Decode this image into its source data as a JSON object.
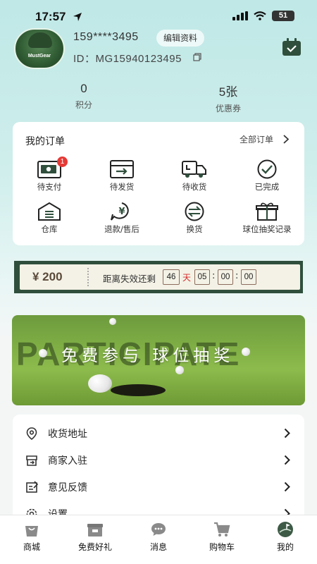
{
  "status": {
    "time": "17:57",
    "battery": "51"
  },
  "profile": {
    "phone": "159****3495",
    "edit_label": "编辑资料",
    "user_id": "ID：MG15940123495",
    "avatar_text": "MustGear"
  },
  "stats": [
    {
      "value": "0",
      "label": "积分"
    },
    {
      "value": "5张",
      "label": "优惠券"
    }
  ],
  "orders": {
    "title": "我的订单",
    "all_label": "全部订单",
    "items": [
      {
        "label": "待支付",
        "icon": "wallet-icon",
        "badge": "1"
      },
      {
        "label": "待发货",
        "icon": "box-ship-icon"
      },
      {
        "label": "待收货",
        "icon": "truck-icon"
      },
      {
        "label": "已完成",
        "icon": "check-circle-icon"
      },
      {
        "label": "仓库",
        "icon": "warehouse-icon"
      },
      {
        "label": "退款/售后",
        "icon": "refund-icon"
      },
      {
        "label": "换货",
        "icon": "exchange-icon"
      },
      {
        "label": "球位抽奖记录",
        "icon": "gift-icon"
      }
    ]
  },
  "coupon": {
    "amount": "¥ 200",
    "countdown_label": "距离失效还剩",
    "days": "46",
    "day_unit": "天",
    "hours": "05",
    "minutes": "00",
    "seconds": "00"
  },
  "banner": {
    "background_word": "PARTICIPATE",
    "headline": "免费参与 球位抽奖"
  },
  "menu": [
    {
      "label": "收货地址",
      "icon": "location-icon"
    },
    {
      "label": "商家入驻",
      "icon": "store-icon"
    },
    {
      "label": "意见反馈",
      "icon": "feedback-icon"
    },
    {
      "label": "设置",
      "icon": "settings-icon"
    }
  ],
  "tabbar": [
    {
      "label": "商城",
      "icon": "shop-bag-icon"
    },
    {
      "label": "免费好礼",
      "icon": "gift-box-icon"
    },
    {
      "label": "消息",
      "icon": "message-icon"
    },
    {
      "label": "购物车",
      "icon": "cart-icon"
    },
    {
      "label": "我的",
      "icon": "golf-profile-icon",
      "active": true
    }
  ],
  "colors": {
    "accent": "#2f4f3c",
    "bg_top": "#bfe8e6",
    "badge": "#e53935",
    "countdown_day": "#d32f2f"
  }
}
